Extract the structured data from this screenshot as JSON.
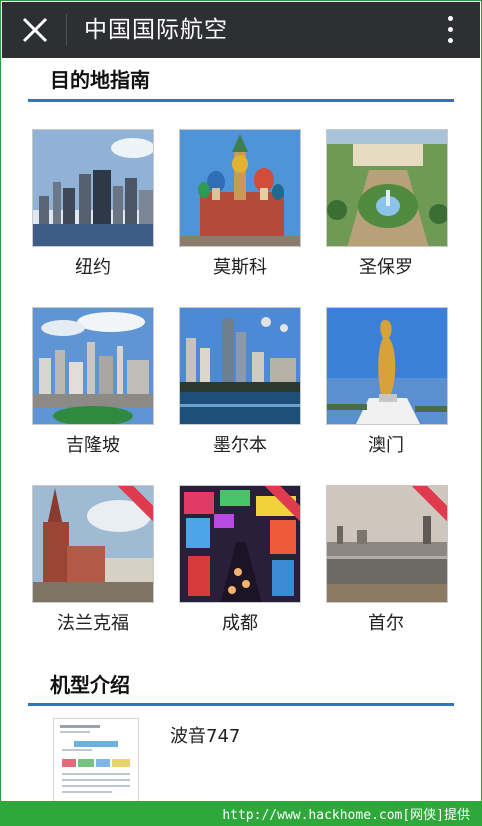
{
  "app": {
    "title": "中国国际航空"
  },
  "destinations": {
    "heading": "目的地指南",
    "items": [
      {
        "name": "纽约",
        "image": "new-york-skyline"
      },
      {
        "name": "莫斯科",
        "image": "moscow-st-basils"
      },
      {
        "name": "圣保罗",
        "image": "sao-paulo-garden"
      },
      {
        "name": "吉隆坡",
        "image": "kuala-lumpur-city"
      },
      {
        "name": "墨尔本",
        "image": "melbourne-river"
      },
      {
        "name": "澳门",
        "image": "macau-statue"
      },
      {
        "name": "法兰克福",
        "image": "frankfurt-cathedral"
      },
      {
        "name": "成都",
        "image": "chengdu-street"
      },
      {
        "name": "首尔",
        "image": "seoul-river"
      }
    ]
  },
  "aircraft": {
    "heading": "机型介绍",
    "items": [
      {
        "name": "波音747"
      }
    ]
  },
  "footer": {
    "text": "http://www.hackhome.com[网侠]提供"
  },
  "colors": {
    "topbar": "#2d2f33",
    "accent_rule": "#2e74c7",
    "footer": "#2fa83b",
    "ribbon": "#e03a4e"
  }
}
